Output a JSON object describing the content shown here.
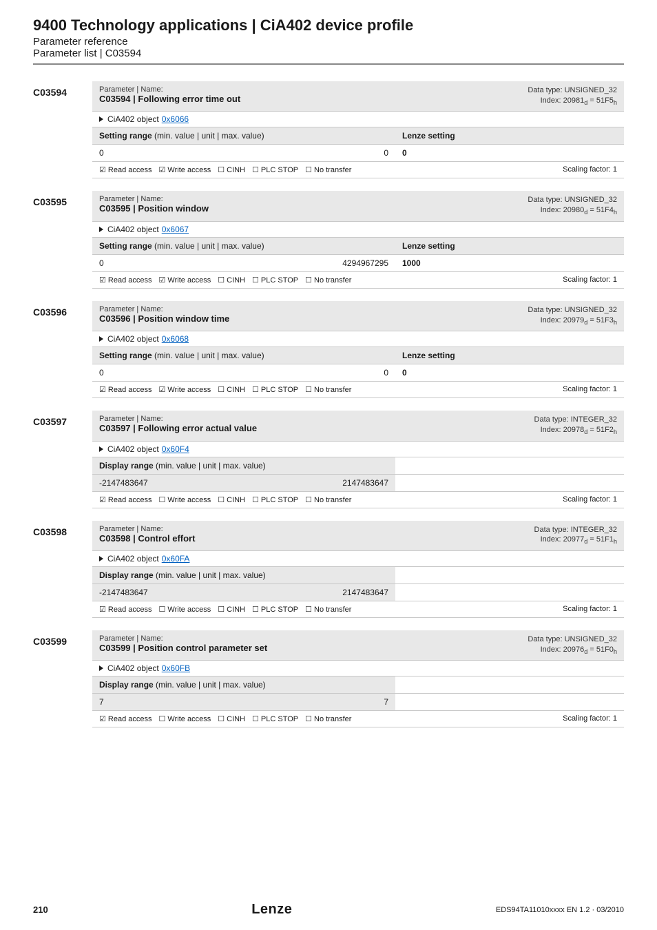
{
  "header": {
    "title": "9400 Technology applications | CiA402 device profile",
    "sub1": "Parameter reference",
    "sub2": "Parameter list | C03594"
  },
  "labels": {
    "param_name": "Parameter | Name:",
    "cia_prefix": "CiA402 object",
    "setting_range": "Setting range (min. value | unit | max. value)",
    "display_range": "Display range (min. value | unit | max. value)",
    "lenze_setting": "Lenze setting",
    "scaling": "Scaling factor: 1",
    "flags": {
      "read_on": "☑ Read access",
      "write_on": "☑ Write access",
      "write_off": "☐ Write access",
      "cinh": "☐ CINH",
      "plc": "☐ PLC STOP",
      "notrans": "☐ No transfer",
      "notrans_sp": "☐  No transfer"
    }
  },
  "params": [
    {
      "code": "C03594",
      "name": "C03594 | Following error time out",
      "dtype": "Data type: UNSIGNED_32",
      "index": "Index: 20981₁ = 51F5ₕ",
      "index_plain_d": "Index: 20981",
      "index_plain_h": " = 51F5",
      "obj": "0x6066",
      "mode": "setting",
      "min": "0",
      "max": "0",
      "lenze": "0",
      "write": true
    },
    {
      "code": "C03595",
      "name": "C03595 | Position window",
      "dtype": "Data type: UNSIGNED_32",
      "index_plain_d": "Index: 20980",
      "index_plain_h": " = 51F4",
      "obj": "0x6067",
      "mode": "setting",
      "min": "0",
      "max": "4294967295",
      "lenze": "1000",
      "write": true
    },
    {
      "code": "C03596",
      "name": "C03596 | Position window time",
      "dtype": "Data type: UNSIGNED_32",
      "index_plain_d": "Index: 20979",
      "index_plain_h": " = 51F3",
      "obj": "0x6068",
      "mode": "setting",
      "min": "0",
      "max": "0",
      "lenze": "0",
      "write": true
    },
    {
      "code": "C03597",
      "name": "C03597 | Following error actual value",
      "dtype": "Data type: INTEGER_32",
      "index_plain_d": "Index: 20978",
      "index_plain_h": " = 51F2",
      "obj": "0x60F4",
      "mode": "display",
      "min": "-2147483647",
      "max": "2147483647",
      "write": false
    },
    {
      "code": "C03598",
      "name": "C03598 | Control effort",
      "dtype": "Data type: INTEGER_32",
      "index_plain_d": "Index: 20977",
      "index_plain_h": " = 51F1",
      "obj": "0x60FA",
      "mode": "display",
      "min": "-2147483647",
      "max": "2147483647",
      "write": false
    },
    {
      "code": "C03599",
      "name": "C03599 | Position control parameter set",
      "dtype": "Data type: UNSIGNED_32",
      "index_plain_d": "Index: 20976",
      "index_plain_h": " = 51F0",
      "obj": "0x60FB",
      "mode": "display",
      "min": "7",
      "max": "7",
      "write": false,
      "notrans_spaced": true
    }
  ],
  "footer": {
    "page": "210",
    "brand": "Lenze",
    "docid": "EDS94TA11010xxxx EN 1.2 · 03/2010"
  }
}
